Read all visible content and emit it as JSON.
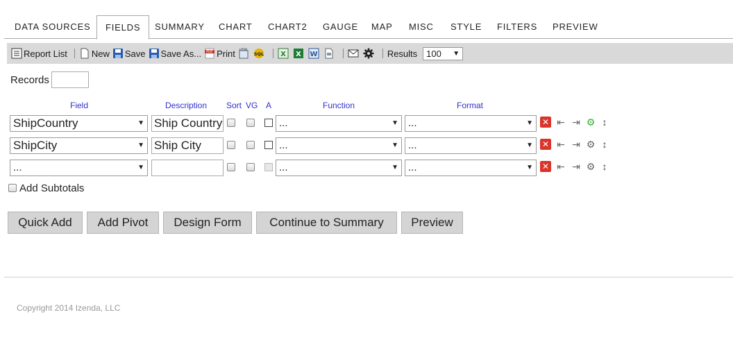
{
  "tabs": [
    "DATA SOURCES",
    "FIELDS",
    "SUMMARY",
    "CHART",
    "CHART2",
    "GAUGE",
    "MAP",
    "MISC",
    "STYLE",
    "FILTERS",
    "PREVIEW"
  ],
  "active_tab": "FIELDS",
  "toolbar": {
    "report_list": "Report List",
    "new": "New",
    "save": "Save",
    "save_as": "Save As...",
    "print": "Print",
    "results_label": "Results",
    "results_value": "100",
    "icons": [
      "report-list-icon",
      "new-document-icon",
      "save-icon",
      "save-as-icon",
      "pdf-icon",
      "html-icon",
      "sql-icon",
      "excel-icon",
      "excel-xlsx-icon",
      "word-icon",
      "xml-icon",
      "email-icon",
      "gear-icon"
    ]
  },
  "records": {
    "label": "Records",
    "value": ""
  },
  "headers": {
    "field": "Field",
    "description": "Description",
    "sort": "Sort",
    "vg": "VG",
    "a": "A",
    "function": "Function",
    "format": "Format"
  },
  "rows": [
    {
      "field": "ShipCountry",
      "description": "Ship Country",
      "function": "...",
      "format": "..."
    },
    {
      "field": "ShipCity",
      "description": "Ship City",
      "function": "...",
      "format": "..."
    },
    {
      "field": "...",
      "description": "",
      "function": "...",
      "format": "..."
    }
  ],
  "add_subtotals": "Add Subtotals",
  "buttons": {
    "quick_add": "Quick Add",
    "add_pivot": "Add Pivot",
    "design_form": "Design Form",
    "continue": "Continue to Summary",
    "preview": "Preview"
  },
  "footer": "Copyright 2014 Izenda, LLC",
  "colors": {
    "header_blue": "#3030cc",
    "toolbar_bg": "#d9d9d9",
    "button_bg": "#d4d4d4",
    "delete_red": "#d9352b"
  }
}
